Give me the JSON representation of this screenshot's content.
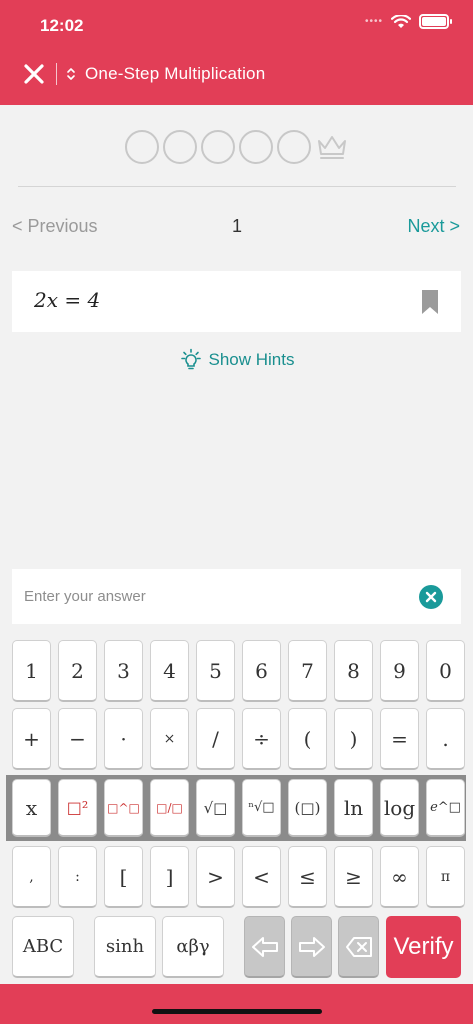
{
  "status": {
    "time": "12:02",
    "signal_dots": "••••"
  },
  "header": {
    "title": "One-Step Multiplication"
  },
  "progress": {
    "total_steps": 5,
    "completed": 0
  },
  "pager": {
    "previous_label": "< Previous",
    "page_number": "1",
    "next_label": "Next >"
  },
  "problem": {
    "equation": "2x = 4"
  },
  "hints": {
    "label": "Show Hints"
  },
  "answer": {
    "placeholder": "Enter your answer",
    "value": ""
  },
  "keyboard": {
    "row1": [
      "1",
      "2",
      "3",
      "4",
      "5",
      "6",
      "7",
      "8",
      "9",
      "0"
    ],
    "row2": [
      "+",
      "−",
      "·",
      "×",
      "/",
      "÷",
      "(",
      ")",
      "=",
      "."
    ],
    "row3": [
      "x",
      "□²",
      "□^□",
      "□/□",
      "√□",
      "ⁿ√□",
      "(□)",
      "ln",
      "log",
      "e^□"
    ],
    "row4": [
      ",",
      ":",
      "[",
      "]",
      ">",
      "<",
      "≤",
      "≥",
      "∞",
      "π"
    ],
    "row5": {
      "abc": "ABC",
      "sinh": "sinh",
      "greek": "αβγ",
      "verify": "Verify"
    }
  },
  "colors": {
    "brand": "#e23e57",
    "accent": "#1a9a9a",
    "background": "#f2f2f2"
  }
}
